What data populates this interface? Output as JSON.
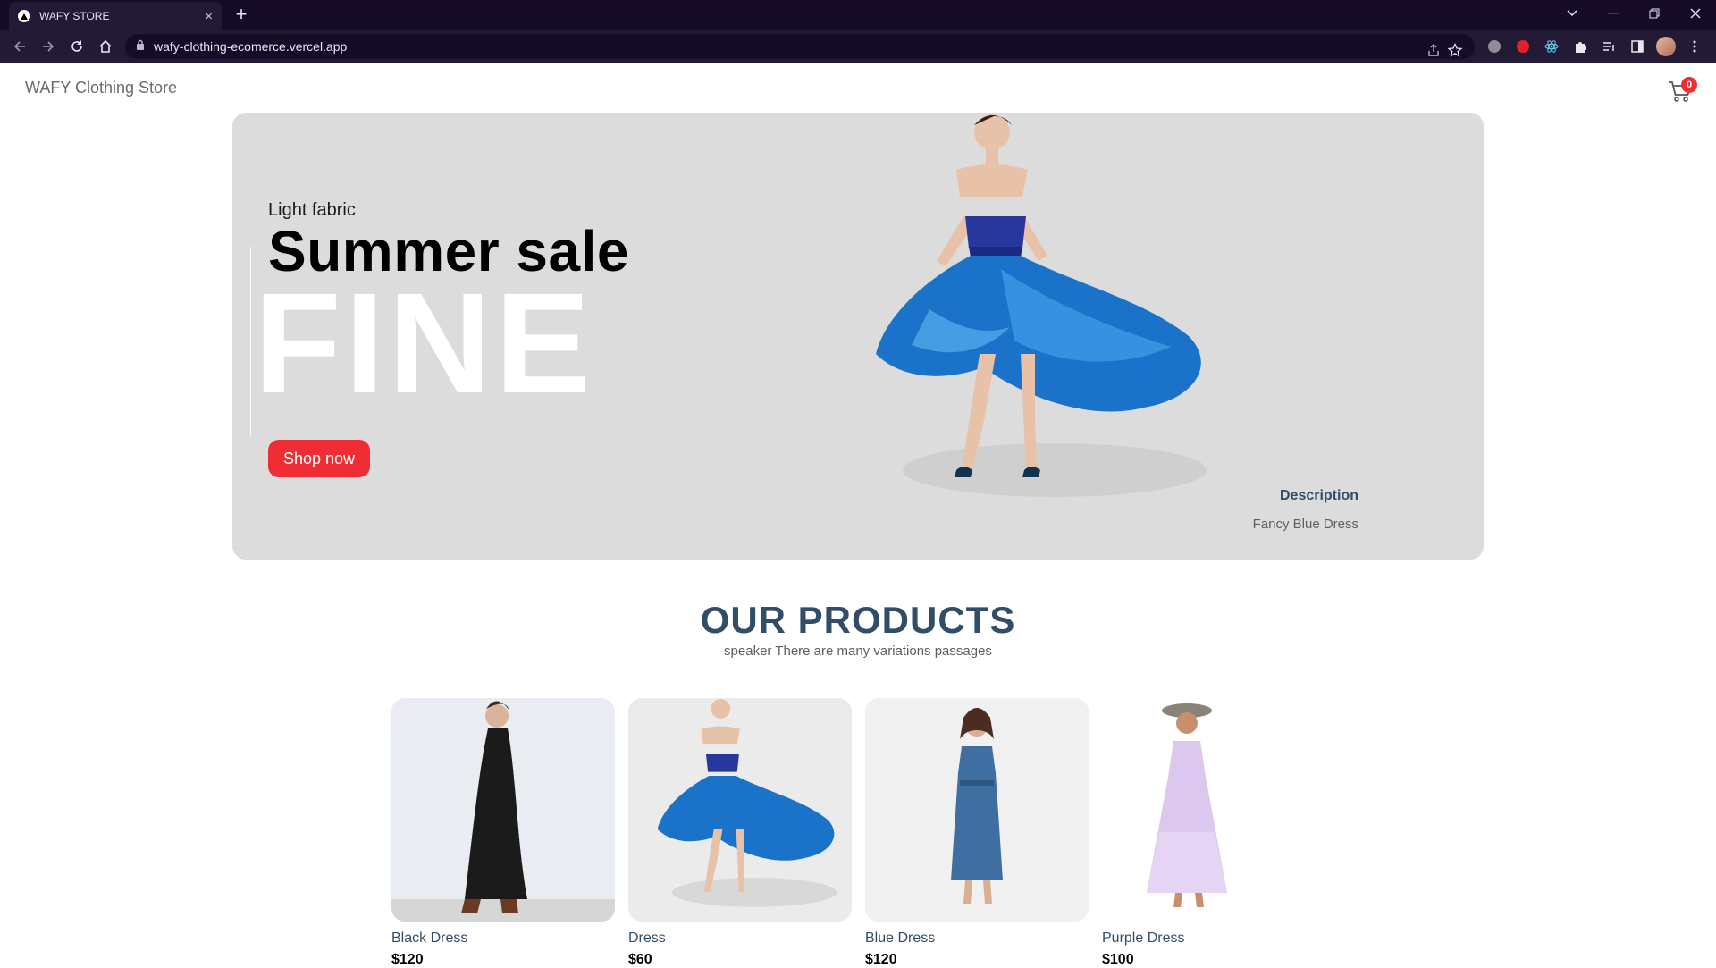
{
  "browser": {
    "tab_title": "WAFY STORE",
    "tab_close": "×",
    "new_tab": "+",
    "url": "wafy-clothing-ecomerce.vercel.app"
  },
  "header": {
    "brand": "WAFY Clothing Store",
    "cart_count": "0"
  },
  "hero": {
    "small_text": "Light fabric",
    "mid_text": "Summer sale",
    "large_text": "FINE",
    "button_label": "Shop now",
    "desc_title": "Description",
    "desc_text": "Fancy Blue Dress"
  },
  "products": {
    "heading": "OUR PRODUCTS",
    "subheading": "speaker There are many variations passages",
    "items": [
      {
        "name": "Black Dress",
        "price": "$120"
      },
      {
        "name": "Dress",
        "price": "$60"
      },
      {
        "name": "Blue Dress",
        "price": "$120"
      },
      {
        "name": "Purple Dress",
        "price": "$100"
      }
    ]
  },
  "colors": {
    "accent": "#f02d34",
    "heading": "#324d67",
    "hero_bg": "#dcdcdc"
  }
}
